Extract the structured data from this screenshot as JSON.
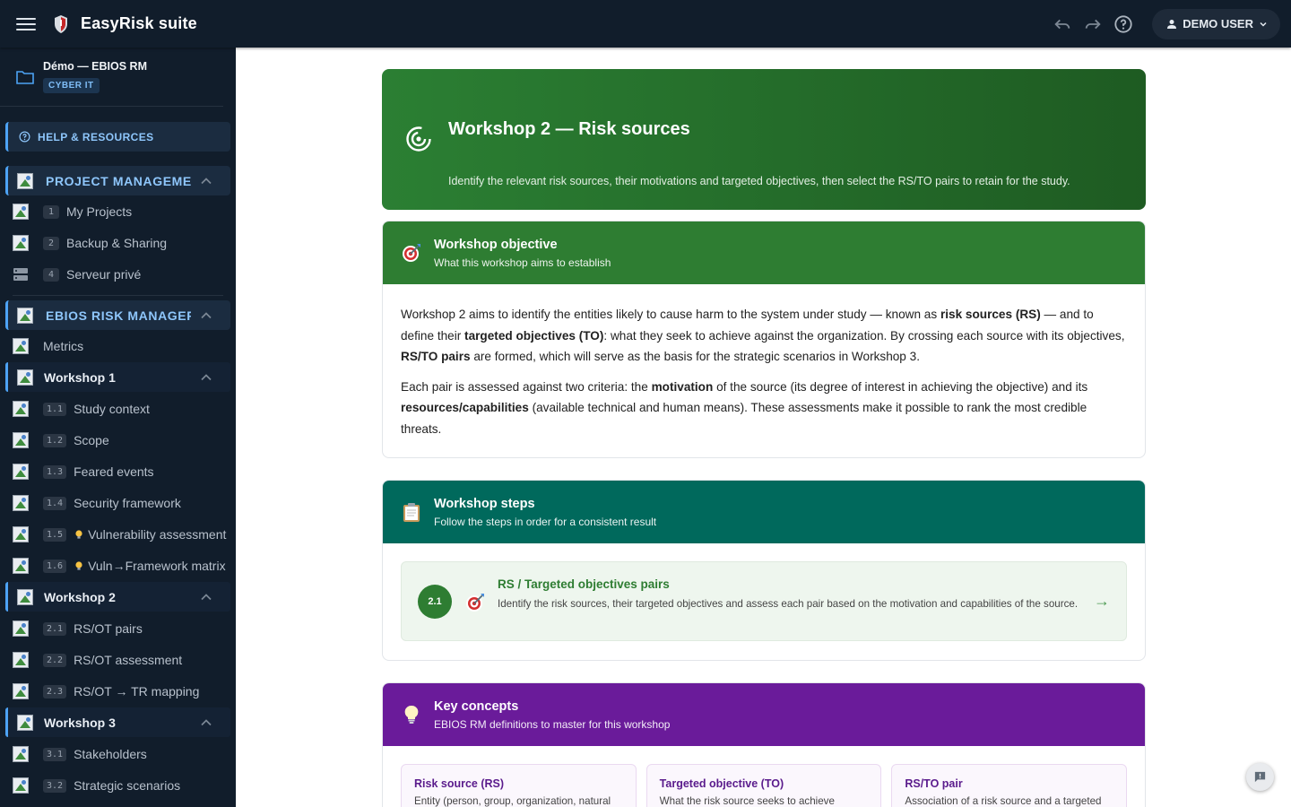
{
  "app": {
    "name": "EasyRisk suite",
    "user_label": "DEMO USER"
  },
  "project": {
    "name": "Démo — EBIOS RM",
    "tag": "CYBER IT"
  },
  "sidebar": {
    "help_label": "HELP & RESOURCES",
    "project_management": {
      "label": "PROJECT MANAGEMENT",
      "items": [
        {
          "num": "1",
          "label": "My Projects"
        },
        {
          "num": "2",
          "label": "Backup & Sharing"
        },
        {
          "num": "4",
          "label": "Serveur privé"
        }
      ]
    },
    "ebios": {
      "label": "EBIOS RISK MANAGER",
      "metrics_label": "Metrics",
      "workshop1": {
        "label": "Workshop 1",
        "items": [
          {
            "num": "1.1",
            "label": "Study context"
          },
          {
            "num": "1.2",
            "label": "Scope"
          },
          {
            "num": "1.3",
            "label": "Feared events"
          },
          {
            "num": "1.4",
            "label": "Security framework"
          },
          {
            "num": "1.5",
            "label": "Vulnerability assessment"
          },
          {
            "num": "1.6",
            "label": "Vuln→Framework matrix"
          }
        ]
      },
      "workshop2": {
        "label": "Workshop 2",
        "items": [
          {
            "num": "2.1",
            "label": "RS/OT pairs"
          },
          {
            "num": "2.2",
            "label": "RS/OT assessment"
          },
          {
            "num": "2.3",
            "label": "RS/OT → TR mapping"
          }
        ]
      },
      "workshop3": {
        "label": "Workshop 3",
        "items": [
          {
            "num": "3.1",
            "label": "Stakeholders"
          },
          {
            "num": "3.2",
            "label": "Strategic scenarios"
          }
        ]
      }
    }
  },
  "hero": {
    "title": "Workshop 2 — Risk sources",
    "subtitle": "Identify the relevant risk sources, their motivations and targeted objectives, then select the RS/TO pairs to retain for the study."
  },
  "objective": {
    "title": "Workshop objective",
    "subtitle": "What this workshop aims to establish",
    "p1": {
      "t1": "Workshop 2 aims to identify the entities likely to cause harm to the system under study — known as ",
      "b1": "risk sources (RS)",
      "t2": " — and to define their ",
      "b2": "targeted objectives (TO)",
      "t3": ": what they seek to achieve against the organization. By crossing each source with its objectives, ",
      "b3": "RS/TO pairs",
      "t4": " are formed, which will serve as the basis for the strategic scenarios in Workshop 3."
    },
    "p2": {
      "t1": "Each pair is assessed against two criteria: the ",
      "b1": "motivation",
      "t2": " of the source (its degree of interest in achieving the objective) and its ",
      "b2": "resources/capabilities",
      "t3": " (available technical and human means). These assessments make it possible to rank the most credible threats."
    }
  },
  "steps": {
    "title": "Workshop steps",
    "subtitle": "Follow the steps in order for a consistent result",
    "items": [
      {
        "num": "2.1",
        "title": "RS / Targeted objectives pairs",
        "desc": "Identify the risk sources, their targeted objectives and assess each pair based on the motivation and capabilities of the source.",
        "arrow": "→"
      }
    ]
  },
  "concepts": {
    "title": "Key concepts",
    "subtitle": "EBIOS RM definitions to master for this workshop",
    "items": [
      {
        "title": "Risk source (RS)",
        "desc": "Entity (person, group, organization, natural"
      },
      {
        "title": "Targeted objective (TO)",
        "desc": "What the risk source seeks to achieve"
      },
      {
        "title": "RS/TO pair",
        "desc": "Association of a risk source and a targeted"
      }
    ]
  },
  "colors": {
    "topbar": "#111d2b",
    "accent_blue": "#4da3f5",
    "objective_green": "#2e7d32",
    "steps_teal": "#00695c",
    "concepts_purple": "#6a1b9a"
  },
  "icons": {
    "menu": "hamburger-icon",
    "logo": "shield-logo-icon",
    "undo": "undo-icon",
    "redo": "redo-icon",
    "help": "help-circle-icon",
    "user": "person-icon",
    "chat": "chat-icon"
  }
}
